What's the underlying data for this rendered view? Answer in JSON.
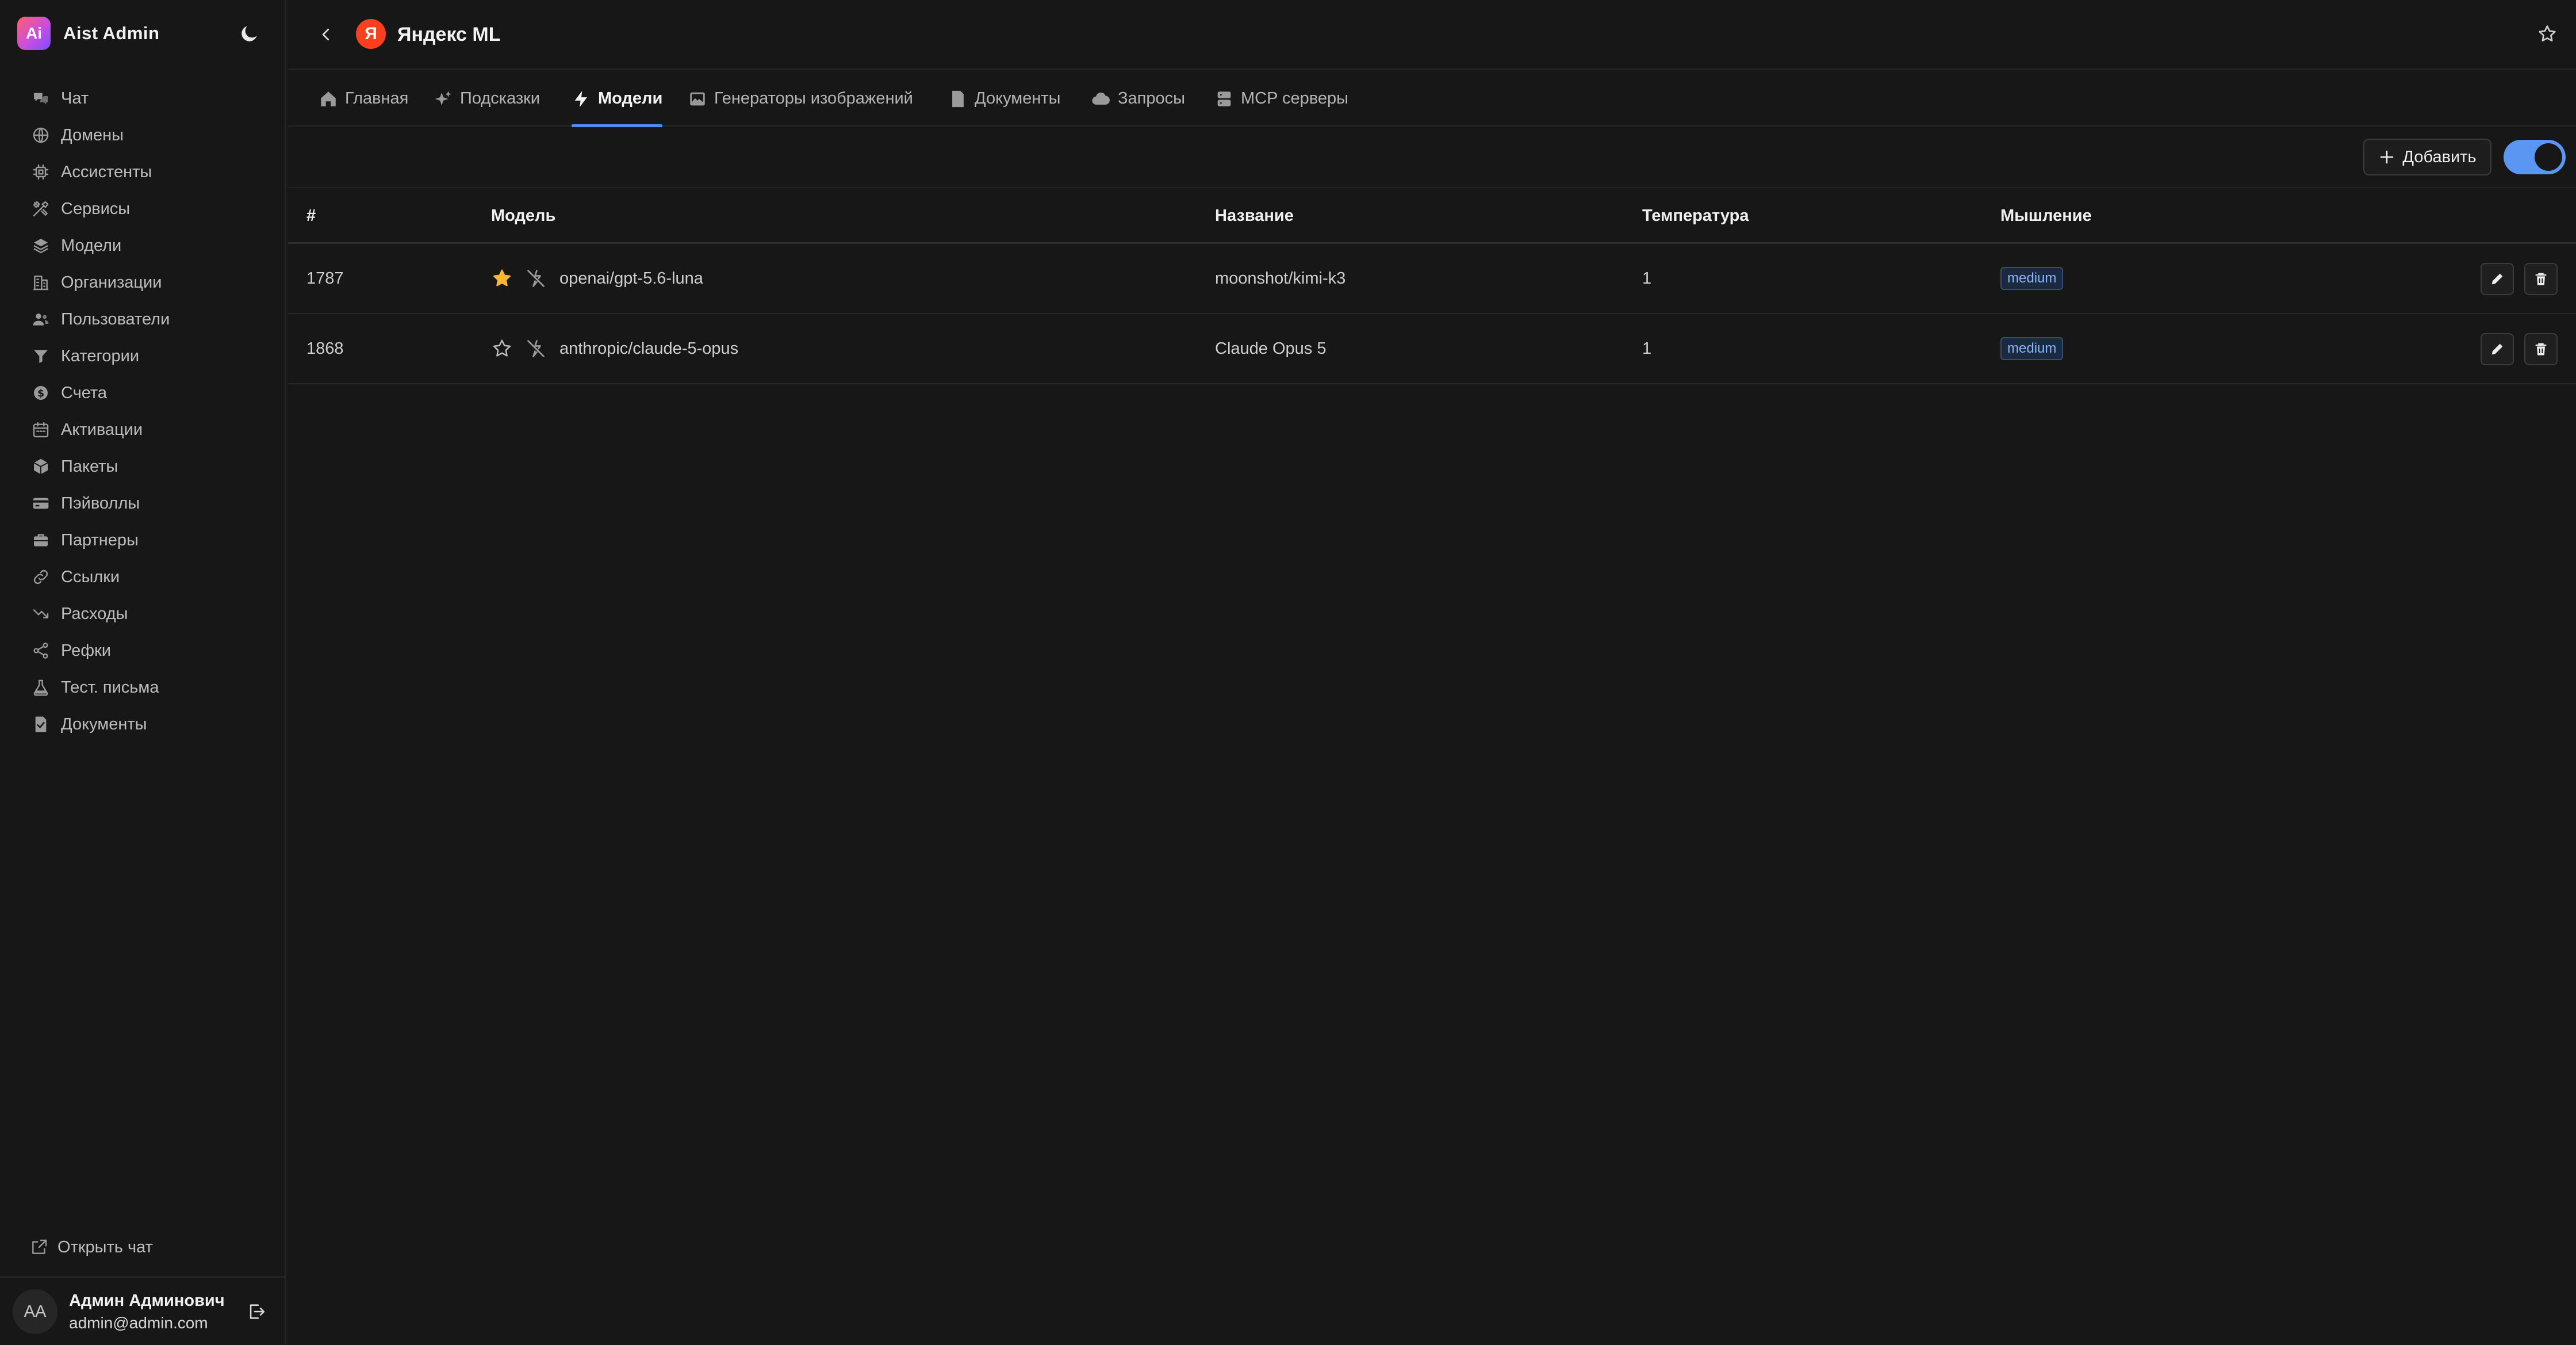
{
  "app": {
    "name": "Aist Admin",
    "logo_text": "Ai"
  },
  "sidebar": {
    "items": [
      {
        "label": "Чат",
        "icon": "chat-bubbles-icon"
      },
      {
        "label": "Домены",
        "icon": "globe-icon"
      },
      {
        "label": "Ассистенты",
        "icon": "chip-icon"
      },
      {
        "label": "Сервисы",
        "icon": "tools-icon"
      },
      {
        "label": "Модели",
        "icon": "layers-icon"
      },
      {
        "label": "Организации",
        "icon": "building-icon"
      },
      {
        "label": "Пользователи",
        "icon": "users-icon"
      },
      {
        "label": "Категории",
        "icon": "filter-icon"
      },
      {
        "label": "Счета",
        "icon": "dollar-circle-icon"
      },
      {
        "label": "Активации",
        "icon": "calendar-icon"
      },
      {
        "label": "Пакеты",
        "icon": "box-icon"
      },
      {
        "label": "Пэйволлы",
        "icon": "credit-card-icon"
      },
      {
        "label": "Партнеры",
        "icon": "briefcase-icon"
      },
      {
        "label": "Ссылки",
        "icon": "link-icon"
      },
      {
        "label": "Расходы",
        "icon": "trend-down-icon"
      },
      {
        "label": "Рефки",
        "icon": "share-icon"
      },
      {
        "label": "Тест. письма",
        "icon": "flask-icon"
      },
      {
        "label": "Документы",
        "icon": "document-check-icon"
      }
    ],
    "open_chat_label": "Открыть чат",
    "user": {
      "initials": "AA",
      "name": "Админ Админович",
      "email": "admin@admin.com"
    }
  },
  "header": {
    "domain_logo_text": "Я",
    "title": "Яндекс ML"
  },
  "tabs": [
    {
      "label": "Главная",
      "icon": "home-icon",
      "active": false
    },
    {
      "label": "Подсказки",
      "icon": "sparkles-icon",
      "active": false
    },
    {
      "label": "Модели",
      "icon": "lightning-icon",
      "active": true
    },
    {
      "label": "Генераторы изображений",
      "icon": "image-icon",
      "active": false
    },
    {
      "label": "Документы",
      "icon": "file-icon",
      "active": false
    },
    {
      "label": "Запросы",
      "icon": "cloud-icon",
      "active": false
    },
    {
      "label": "MCP серверы",
      "icon": "server-icon",
      "active": false
    }
  ],
  "toolbar": {
    "add_label": "Добавить",
    "toggle_on": true
  },
  "table": {
    "columns": {
      "id": "#",
      "model": "Модель",
      "name": "Название",
      "temperature": "Температура",
      "thinking": "Мышление"
    },
    "rows": [
      {
        "id": "1787",
        "starred": true,
        "model": "openai/gpt-5.6-luna",
        "name": "moonshot/kimi-k3",
        "temperature": "1",
        "thinking": "medium"
      },
      {
        "id": "1868",
        "starred": false,
        "model": "anthropic/claude-5-opus",
        "name": "Claude Opus 5",
        "temperature": "1",
        "thinking": "medium"
      }
    ]
  },
  "colors": {
    "accent": "#4d8bf5",
    "star": "#f5b82e",
    "badge_text": "#8ab4f8",
    "yandex_red": "#fc3f1d"
  }
}
